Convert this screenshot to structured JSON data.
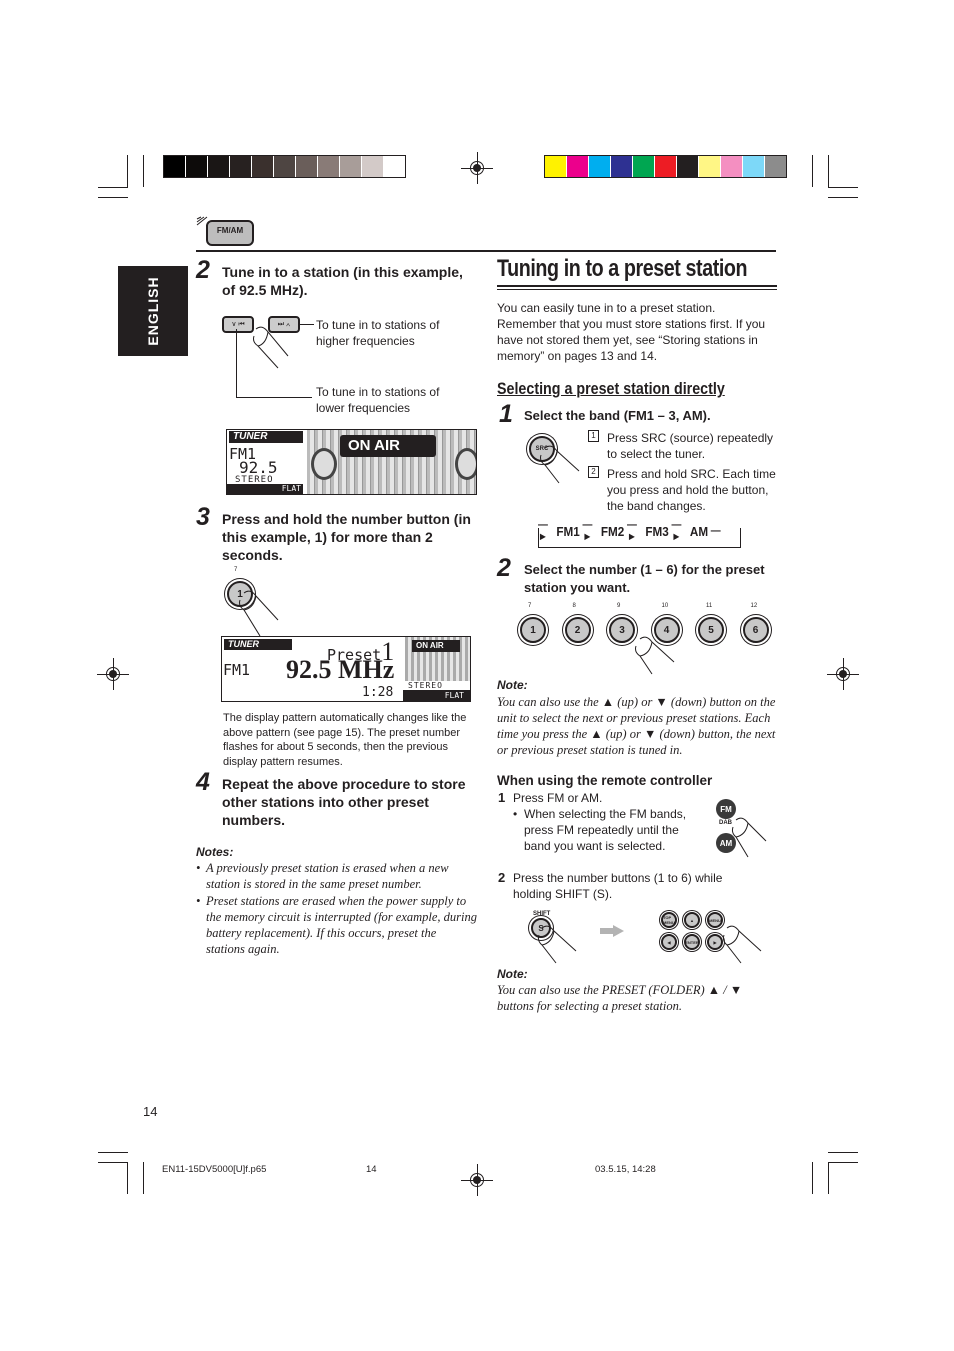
{
  "print_marks": {
    "gray_swatches": [
      "#000000",
      "#0d0b0a",
      "#1a1615",
      "#272120",
      "#3a302d",
      "#4e4542",
      "#6a5e5a",
      "#897b77",
      "#a89d99",
      "#d3cac8",
      "#ffffff"
    ],
    "color_swatches": [
      "#fff200",
      "#ec008c",
      "#00aeef",
      "#2e3192",
      "#00a651",
      "#ed1c24",
      "#231f20",
      "#fff685",
      "#f48fc1",
      "#7dd8f8",
      "#8c8c8c"
    ]
  },
  "section_icon": {
    "label": "FM/AM"
  },
  "sidebar": {
    "language_tab": "ENGLISH"
  },
  "left": {
    "step2": {
      "num": "2",
      "heading": "Tune in to a station (in this example, of 92.5 MHz).",
      "btn_down": "∨ ⏮",
      "btn_up": "⏭ ∧",
      "callout_higher": "To tune in to stations of higher frequencies",
      "callout_lower": "To tune in to stations of lower frequencies",
      "display": {
        "logo": "TUNER",
        "band": "FM1",
        "freq": "92.5",
        "stereo": "STEREO",
        "eq": "FLAT",
        "onair": "ON AIR"
      }
    },
    "step3": {
      "num": "3",
      "heading": "Press and hold the number button (in this example, 1) for more than 2 seconds.",
      "button_small_label": "7",
      "button_label": "1",
      "display": {
        "logo": "TUNER",
        "band": "FM1",
        "freq": "92.5 MHz",
        "preset": "Preset",
        "preset_num": "1",
        "time": "1:28",
        "stereo": "STEREO",
        "eq": "FLAT",
        "onair": "ON AIR"
      },
      "caption": "The display pattern automatically changes like the above pattern (see page 15). The preset number flashes for about 5 seconds, then the previous display pattern resumes."
    },
    "step4": {
      "num": "4",
      "heading": "Repeat the above procedure to store other stations into other preset numbers."
    },
    "notes": {
      "title": "Notes:",
      "items": [
        "A previously preset station is erased when a new station is stored in the same preset number.",
        "Preset stations are erased when the power supply to the memory circuit is interrupted (for example, during battery replacement). If this occurs, preset the stations again."
      ]
    }
  },
  "right": {
    "title": "Tuning in to a preset station",
    "intro": "You can easily tune in to a preset station. Remember that you must store stations first. If you have not stored them yet, see “Storing stations in memory” on pages 13 and 14.",
    "subtitle": "Selecting a preset station directly",
    "step1": {
      "num": "1",
      "heading": "Select the band (FM1 – 3, AM).",
      "src_label": "SRC",
      "items": [
        {
          "n": "1",
          "text": "Press SRC (source) repeatedly to select the tuner."
        },
        {
          "n": "2",
          "text": "Press and hold SRC. Each time you press and hold the button, the band changes."
        }
      ],
      "cycle": [
        "FM1",
        "FM2",
        "FM3",
        "AM"
      ]
    },
    "step2": {
      "num": "2",
      "heading": "Select the number (1 – 6) for the preset station you want.",
      "buttons": [
        {
          "small": "7",
          "label": "1"
        },
        {
          "small": "8",
          "label": "2"
        },
        {
          "small": "9",
          "label": "3"
        },
        {
          "small": "10",
          "label": "4"
        },
        {
          "small": "11",
          "label": "5"
        },
        {
          "small": "12",
          "label": "6"
        }
      ]
    },
    "note1": {
      "title": "Note:",
      "text": "You can also use the ▲ (up) or ▼ (down) button on the unit to select the next or previous preset stations. Each time you press the ▲ (up) or ▼ (down) button, the next or previous preset station is tuned in."
    },
    "remote": {
      "heading": "When using the remote controller",
      "s1_num": "1",
      "s1_text": "Press FM or AM.",
      "s1_bullet": "When selecting the FM bands, press FM repeatedly until the band you want is selected.",
      "fm_label": "FM",
      "dab_label": "DAB",
      "am_label": "AM",
      "s2_num": "2",
      "s2_text": "Press the number buttons (1 to 6) while holding SHIFT (S).",
      "shift_label": "SHIFT",
      "s_label": "S",
      "remote_keys": [
        "TOP MENU",
        "▲",
        "MENU",
        "◀",
        "ENTER",
        "▶"
      ]
    },
    "note2": {
      "title": "Note:",
      "text": "You can also use the PRESET (FOLDER) ▲ / ▼ buttons for selecting a preset station."
    }
  },
  "footer": {
    "page_number": "14",
    "file_name": "EN11-15DV5000[U]f.p65",
    "sheet": "14",
    "timestamp": "03.5.15, 14:28"
  }
}
